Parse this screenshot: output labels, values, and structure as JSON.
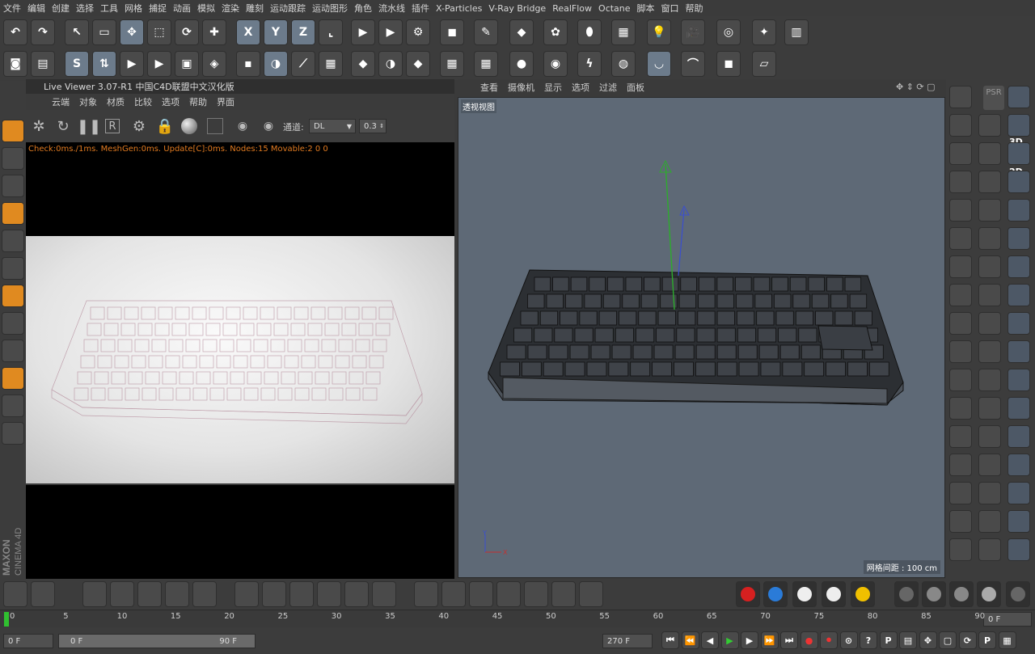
{
  "menu": [
    "文件",
    "编辑",
    "创建",
    "选择",
    "工具",
    "网格",
    "捕捉",
    "动画",
    "模拟",
    "渲染",
    "雕刻",
    "运动跟踪",
    "运动图形",
    "角色",
    "流水线",
    "插件",
    "X-Particles",
    "V-Ray Bridge",
    "RealFlow",
    "Octane",
    "脚本",
    "窗口",
    "帮助"
  ],
  "toolbar1": [
    {
      "name": "undo-icon",
      "g": "↶"
    },
    {
      "name": "redo-icon",
      "g": "↷"
    },
    {
      "name": "select-live-icon",
      "g": "↖"
    },
    {
      "name": "select-rect-icon",
      "g": "▭"
    },
    {
      "name": "move-icon",
      "g": "✥"
    },
    {
      "name": "scale-icon",
      "g": "⬚"
    },
    {
      "name": "rotate-icon",
      "g": "⟳"
    },
    {
      "name": "recent-tool-icon",
      "g": "✚"
    },
    {
      "name": "axis-x-icon",
      "g": "X"
    },
    {
      "name": "axis-y-icon",
      "g": "Y"
    },
    {
      "name": "axis-z-icon",
      "g": "Z"
    },
    {
      "name": "coord-system-icon",
      "g": "⌞"
    },
    {
      "name": "render-view-icon",
      "g": "▶"
    },
    {
      "name": "render-picture-viewer-icon",
      "g": "▶"
    },
    {
      "name": "render-settings-icon",
      "g": "⚙"
    },
    {
      "name": "cube-icon",
      "g": "◼"
    },
    {
      "name": "pen-icon",
      "g": "✎"
    },
    {
      "name": "subdivision-icon",
      "g": "◆"
    },
    {
      "name": "cloner-icon",
      "g": "✿"
    },
    {
      "name": "deformer-icon",
      "g": "⬮"
    },
    {
      "name": "floor-icon",
      "g": "▦"
    },
    {
      "name": "light-icon",
      "g": "💡"
    },
    {
      "name": "camera-icon",
      "g": "🎥"
    },
    {
      "name": "tag-icon",
      "g": "◎"
    },
    {
      "name": "sculpt-icon",
      "g": "✦"
    },
    {
      "name": "layer-icon",
      "g": "▥"
    }
  ],
  "toolbar2": [
    {
      "name": "view-camera-icon",
      "g": "◙"
    },
    {
      "name": "document-icon",
      "g": "▤"
    },
    {
      "name": "snap-s-icon",
      "g": "S"
    },
    {
      "name": "arrows-icon",
      "g": "⇅"
    },
    {
      "name": "ipr-icon",
      "g": "▶"
    },
    {
      "name": "clapper-icon",
      "g": "▶"
    },
    {
      "name": "render-region-icon",
      "g": "▣"
    },
    {
      "name": "workplane-icon",
      "g": "◈"
    },
    {
      "name": "points-mode-icon",
      "g": "▪"
    },
    {
      "name": "edges-mode-icon",
      "g": "◑"
    },
    {
      "name": "knife-icon",
      "g": "⟋"
    },
    {
      "name": "polygons-mode-icon",
      "g": "▦"
    },
    {
      "name": "uv-polygons-icon",
      "g": "◆"
    },
    {
      "name": "texture-mode-icon",
      "g": "◑"
    },
    {
      "name": "material-mode-icon",
      "g": "◆"
    },
    {
      "name": "uv-points-icon",
      "g": "▦"
    },
    {
      "name": "workplane-lock-icon",
      "g": "▦"
    },
    {
      "name": "sphere-icon",
      "g": "●"
    },
    {
      "name": "octane-viewport-icon",
      "g": "◉"
    },
    {
      "name": "flash-icon",
      "g": "ϟ"
    },
    {
      "name": "globe-icon",
      "g": "◍"
    },
    {
      "name": "cup-icon",
      "g": "◡"
    },
    {
      "name": "pipe-icon",
      "g": "⌒"
    },
    {
      "name": "box-icon",
      "g": "◼"
    },
    {
      "name": "workplane-grid-icon",
      "g": "▱"
    }
  ],
  "left_tools": [
    "cube-mode-icon",
    "checker-icon",
    "polygon-mode-icon",
    "edge-mode-icon",
    "solid-mode-icon",
    "orange-cube-icon",
    "axis-icon",
    "mouse-icon",
    "snap-icon",
    "magnet-icon",
    "lock-grid-icon",
    "grid-snap-icon"
  ],
  "live_viewer": {
    "title": "Live Viewer 3.07-R1 中国C4D联盟中文汉化版",
    "menu": [
      "云端",
      "对象",
      "材质",
      "比较",
      "选项",
      "帮助",
      "界面"
    ],
    "channel_label": "通道:",
    "channel_value": "DL",
    "value": "0.3",
    "status": "Check:0ms./1ms. MeshGen:0ms. Update[C]:0ms. Nodes:15 Movable:2  0 0"
  },
  "viewport": {
    "menu": [
      "查看",
      "摄像机",
      "显示",
      "选项",
      "过滤",
      "面板"
    ],
    "label": "透视视图",
    "grid": "网格间距 : 100 cm"
  },
  "right_a": [
    "psr-icon",
    "3d-snap-icon",
    "2d-snap-icon",
    "snap-settings-icon",
    "workplane-icon",
    "axis-lock-icon",
    "snap-point-icon",
    "snap-polygon-icon",
    "snap-edge-icon",
    "snap-spline-icon",
    "magnet-icon",
    "quantize-icon",
    "guide-icon"
  ],
  "right_labels": {
    "psr": "PSR",
    "r3d": "3D",
    "r2d": "2D"
  },
  "timeline": {
    "ticks": [
      "0",
      "5",
      "10",
      "15",
      "20",
      "25",
      "30",
      "35",
      "40",
      "45",
      "50",
      "55",
      "60",
      "65",
      "70",
      "75",
      "80",
      "85",
      "90"
    ],
    "frame_field": "0 F"
  },
  "controls": {
    "start": "0 F",
    "range_start": "0 F",
    "range_end": "90 F",
    "end": "270 F"
  },
  "logo": {
    "line1": "MAXON",
    "line2": "CINEMA 4D"
  },
  "colors": {
    "accent": "#7a8fa4",
    "axis_y": "#2dab2d",
    "axis_z": "#3a4ed0",
    "status": "#e07a20"
  }
}
